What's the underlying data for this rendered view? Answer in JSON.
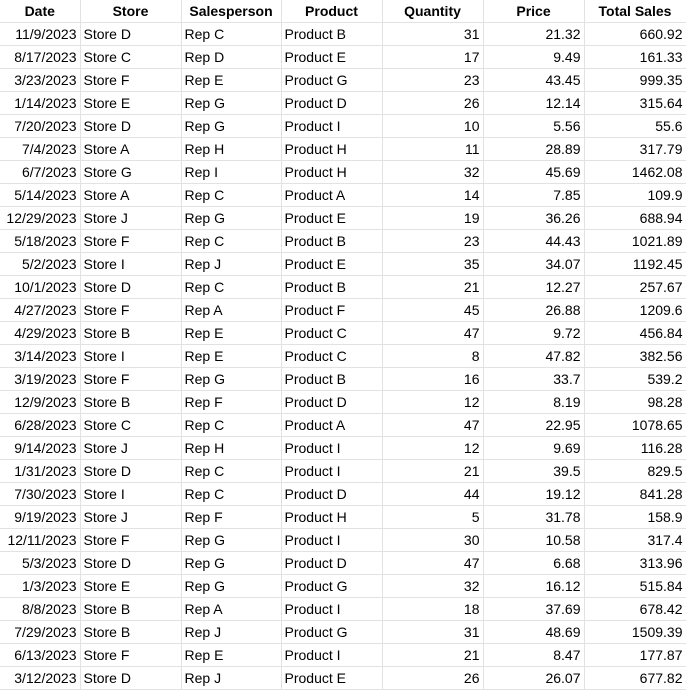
{
  "columns": [
    "Date",
    "Store",
    "Salesperson",
    "Product",
    "Quantity",
    "Price",
    "Total Sales"
  ],
  "rows": [
    [
      "11/9/2023",
      "Store D",
      "Rep C",
      "Product B",
      "31",
      "21.32",
      "660.92"
    ],
    [
      "8/17/2023",
      "Store C",
      "Rep D",
      "Product E",
      "17",
      "9.49",
      "161.33"
    ],
    [
      "3/23/2023",
      "Store F",
      "Rep E",
      "Product G",
      "23",
      "43.45",
      "999.35"
    ],
    [
      "1/14/2023",
      "Store E",
      "Rep G",
      "Product D",
      "26",
      "12.14",
      "315.64"
    ],
    [
      "7/20/2023",
      "Store D",
      "Rep G",
      "Product I",
      "10",
      "5.56",
      "55.6"
    ],
    [
      "7/4/2023",
      "Store A",
      "Rep H",
      "Product H",
      "11",
      "28.89",
      "317.79"
    ],
    [
      "6/7/2023",
      "Store G",
      "Rep I",
      "Product H",
      "32",
      "45.69",
      "1462.08"
    ],
    [
      "5/14/2023",
      "Store A",
      "Rep C",
      "Product A",
      "14",
      "7.85",
      "109.9"
    ],
    [
      "12/29/2023",
      "Store J",
      "Rep G",
      "Product E",
      "19",
      "36.26",
      "688.94"
    ],
    [
      "5/18/2023",
      "Store F",
      "Rep C",
      "Product B",
      "23",
      "44.43",
      "1021.89"
    ],
    [
      "5/2/2023",
      "Store I",
      "Rep J",
      "Product E",
      "35",
      "34.07",
      "1192.45"
    ],
    [
      "10/1/2023",
      "Store D",
      "Rep C",
      "Product B",
      "21",
      "12.27",
      "257.67"
    ],
    [
      "4/27/2023",
      "Store F",
      "Rep A",
      "Product F",
      "45",
      "26.88",
      "1209.6"
    ],
    [
      "4/29/2023",
      "Store B",
      "Rep E",
      "Product C",
      "47",
      "9.72",
      "456.84"
    ],
    [
      "3/14/2023",
      "Store I",
      "Rep E",
      "Product C",
      "8",
      "47.82",
      "382.56"
    ],
    [
      "3/19/2023",
      "Store F",
      "Rep G",
      "Product B",
      "16",
      "33.7",
      "539.2"
    ],
    [
      "12/9/2023",
      "Store B",
      "Rep F",
      "Product D",
      "12",
      "8.19",
      "98.28"
    ],
    [
      "6/28/2023",
      "Store C",
      "Rep C",
      "Product A",
      "47",
      "22.95",
      "1078.65"
    ],
    [
      "9/14/2023",
      "Store J",
      "Rep H",
      "Product I",
      "12",
      "9.69",
      "116.28"
    ],
    [
      "1/31/2023",
      "Store D",
      "Rep C",
      "Product I",
      "21",
      "39.5",
      "829.5"
    ],
    [
      "7/30/2023",
      "Store I",
      "Rep C",
      "Product D",
      "44",
      "19.12",
      "841.28"
    ],
    [
      "9/19/2023",
      "Store J",
      "Rep F",
      "Product H",
      "5",
      "31.78",
      "158.9"
    ],
    [
      "12/11/2023",
      "Store F",
      "Rep G",
      "Product I",
      "30",
      "10.58",
      "317.4"
    ],
    [
      "5/3/2023",
      "Store D",
      "Rep G",
      "Product D",
      "47",
      "6.68",
      "313.96"
    ],
    [
      "1/3/2023",
      "Store E",
      "Rep G",
      "Product G",
      "32",
      "16.12",
      "515.84"
    ],
    [
      "8/8/2023",
      "Store B",
      "Rep A",
      "Product I",
      "18",
      "37.69",
      "678.42"
    ],
    [
      "7/29/2023",
      "Store B",
      "Rep J",
      "Product G",
      "31",
      "48.69",
      "1509.39"
    ],
    [
      "6/13/2023",
      "Store F",
      "Rep E",
      "Product I",
      "21",
      "8.47",
      "177.87"
    ],
    [
      "3/12/2023",
      "Store D",
      "Rep J",
      "Product E",
      "26",
      "26.07",
      "677.82"
    ]
  ]
}
